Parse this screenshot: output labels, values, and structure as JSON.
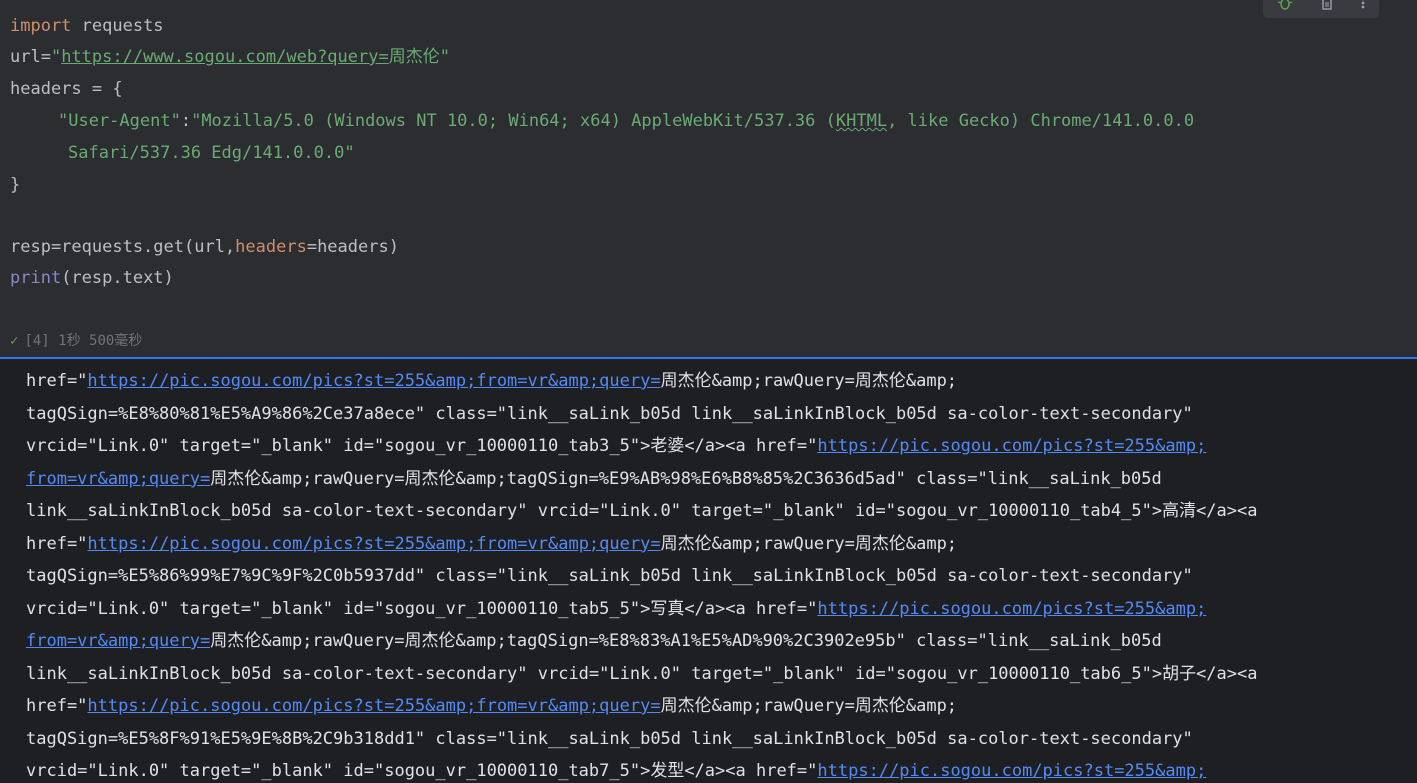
{
  "cell": {
    "lines": {
      "l1_kw": "import",
      "l1_rest": " requests",
      "l2_var": "url=",
      "l2_q1": "\"",
      "l2_url": "https://www.sogou.com/web?query=",
      "l2_cjk": "周杰伦",
      "l2_q2": "\"",
      "l3": "headers = {",
      "l4_str1": "\"User-Agent\"",
      "l4_colon": ":",
      "l4_str2a": "\"Mozilla/5.0 (Windows NT 10.0; Win64; x64) AppleWebKit/537.36 (",
      "l4_khtml": "KHTML",
      "l4_str2b": ", like Gecko) Chrome/141.0.0.0",
      "l5_str": "Safari/537.36 Edg/141.0.0.0\"",
      "l6": "}",
      "l8_a": "resp=requests.get(url,",
      "l8_param": "headers",
      "l8_b": "=headers)",
      "l9_fn": "print",
      "l9_rest": "(resp.text)"
    },
    "status_text": "[4] 1秒 500毫秒",
    "toolbar": {
      "debug_icon": "bug-icon",
      "delete_icon": "trash-icon",
      "more_icon": "more-vertical-icon"
    }
  },
  "output": {
    "lines": [
      {
        "a": "href=\"",
        "link": "https://pic.sogou.com/pics?st=255&amp;from=vr&amp;query=",
        "b": "周杰伦&amp;rawQuery=周杰伦&amp;"
      },
      {
        "a": "tagQSign=%E8%80%81%E5%A9%86%2Ce37a8ece\" class=\"link__saLink_b05d link__saLinkInBlock_b05d sa-color-text-secondary\""
      },
      {
        "a": "vrcid=\"Link.0\" target=\"_blank\" id=\"sogou_vr_10000110_tab3_5\">老婆</a><a href=\"",
        "link": "https://pic.sogou.com/pics?st=255&amp;"
      },
      {
        "link": "from=vr&amp;query=",
        "b": "周杰伦&amp;rawQuery=周杰伦&amp;tagQSign=%E9%AB%98%E6%B8%85%2C3636d5ad\" class=\"link__saLink_b05d"
      },
      {
        "a": "link__saLinkInBlock_b05d sa-color-text-secondary\" vrcid=\"Link.0\" target=\"_blank\" id=\"sogou_vr_10000110_tab4_5\">高清</a><a"
      },
      {
        "a": "href=\"",
        "link": "https://pic.sogou.com/pics?st=255&amp;from=vr&amp;query=",
        "b": "周杰伦&amp;rawQuery=周杰伦&amp;"
      },
      {
        "a": "tagQSign=%E5%86%99%E7%9C%9F%2C0b5937dd\" class=\"link__saLink_b05d link__saLinkInBlock_b05d sa-color-text-secondary\""
      },
      {
        "a": "vrcid=\"Link.0\" target=\"_blank\" id=\"sogou_vr_10000110_tab5_5\">写真</a><a href=\"",
        "link": "https://pic.sogou.com/pics?st=255&amp;"
      },
      {
        "link": "from=vr&amp;query=",
        "b": "周杰伦&amp;rawQuery=周杰伦&amp;tagQSign=%E8%83%A1%E5%AD%90%2C3902e95b\" class=\"link__saLink_b05d"
      },
      {
        "a": "link__saLinkInBlock_b05d sa-color-text-secondary\" vrcid=\"Link.0\" target=\"_blank\" id=\"sogou_vr_10000110_tab6_5\">胡子</a><a"
      },
      {
        "a": "href=\"",
        "link": "https://pic.sogou.com/pics?st=255&amp;from=vr&amp;query=",
        "b": "周杰伦&amp;rawQuery=周杰伦&amp;"
      },
      {
        "a": "tagQSign=%E5%8F%91%E5%9E%8B%2C9b318dd1\" class=\"link__saLink_b05d link__saLinkInBlock_b05d sa-color-text-secondary\""
      },
      {
        "a": "vrcid=\"Link.0\" target=\"_blank\" id=\"sogou_vr_10000110_tab7_5\">发型</a><a href=\"",
        "link": "https://pic.sogou.com/pics?st=255&amp;"
      }
    ]
  },
  "colors": {
    "editor_bg": "#2b2d30",
    "output_bg": "#1e1f22",
    "keyword": "#cf8e6d",
    "string": "#6aab73",
    "link": "#548af7",
    "divider": "#3574f0"
  }
}
